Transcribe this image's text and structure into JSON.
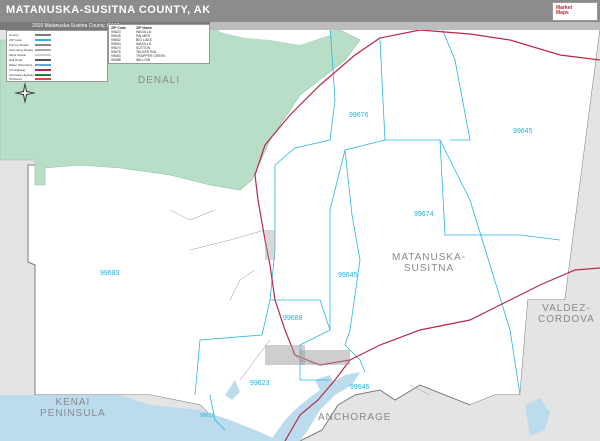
{
  "header": {
    "title": "MATANUSKA-SUSITNA COUNTY, AK",
    "logo_text": "Market\nMaps",
    "subtitle": "2016 Matanuska-Susitna County, AK Map"
  },
  "legend": {
    "items": [
      "County",
      "ZIP Code",
      "Primary Roads",
      "Secondary Roads",
      "Minor Roads",
      "Rail Road",
      "Water (Shoreline)",
      "US Highway",
      "Interstate Highway",
      "Toll Road"
    ]
  },
  "zip_table": {
    "headers": [
      "ZIP Code",
      "ZIP Name"
    ],
    "rows": [
      [
        "99623",
        "WASILLA"
      ],
      [
        "99645",
        "PALMER"
      ],
      [
        "99652",
        "BIG LAKE"
      ],
      [
        "99654",
        "WASILLA"
      ],
      [
        "99674",
        "SUTTON"
      ],
      [
        "99676",
        "TALKEETNA"
      ],
      [
        "99683",
        "TRAPPER CREEK"
      ],
      [
        "99688",
        "WILLOW"
      ]
    ]
  },
  "regions": {
    "denali": "DENALI",
    "matsu": "MATANUSKA-\nSUSITNA",
    "valdez": "VALDEZ-\nCORDOVA",
    "kenai": "KENAI\nPENINSULA",
    "anchorage": "ANCHORAGE"
  },
  "zips": {
    "z99676": "99676",
    "z99645a": "99645",
    "z99674": "99674",
    "z99683": "99683",
    "z99645b": "99645",
    "z99688": "99688",
    "z99623": "99623",
    "z99645c": "99645",
    "z99652": "99652"
  },
  "colors": {
    "park": "#b7dfc7",
    "water": "#b9d9ec",
    "outside": "#e6e6e6",
    "zip_line": "#27b6e3",
    "highway": "#b8294a"
  }
}
